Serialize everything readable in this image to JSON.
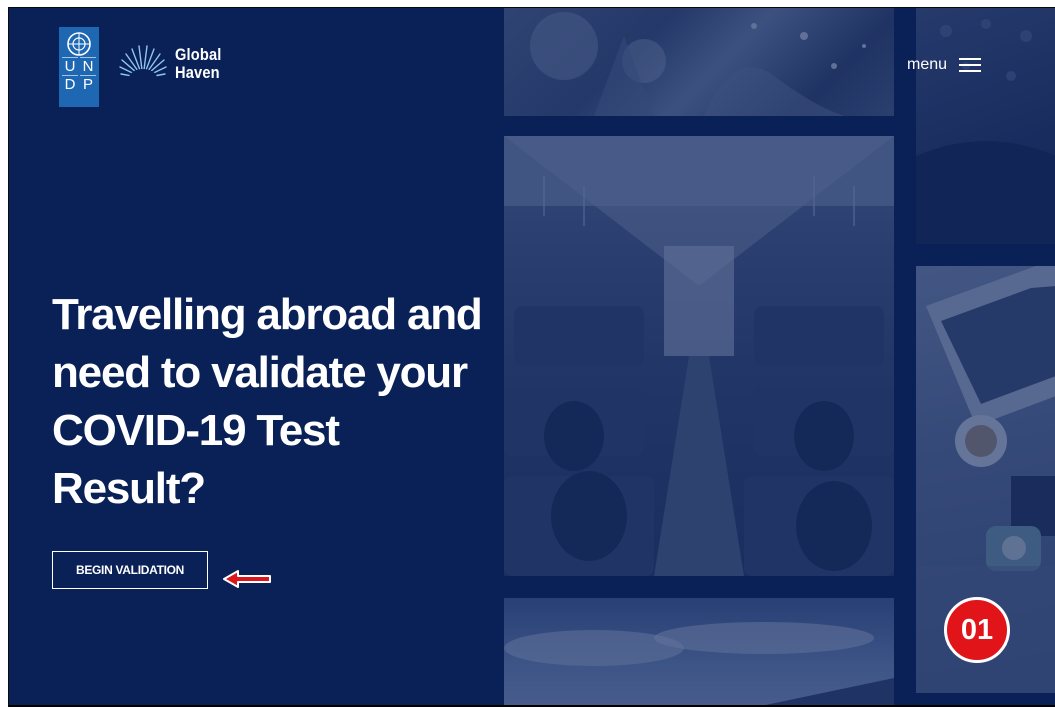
{
  "logos": {
    "undp_letters": [
      "U",
      "N",
      "D",
      "P"
    ],
    "brand_line1": "Global",
    "brand_line2": "Haven"
  },
  "header": {
    "menu_label": "menu",
    "menu_icon": "hamburger-icon"
  },
  "hero": {
    "headline": "Travelling abroad and need to validate your COVID-19 Test Result?",
    "cta_label": "BEGIN VALIDATION"
  },
  "annotation": {
    "step_badge": "01",
    "arrow_icon": "left-arrow-icon"
  },
  "colors": {
    "background": "#0a2157",
    "undp_blue": "#1e67b3",
    "badge_red": "#e1141a",
    "arrow_red": "#d9181e",
    "text": "#ffffff"
  }
}
